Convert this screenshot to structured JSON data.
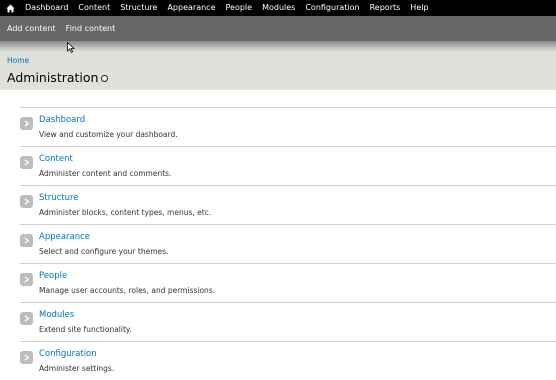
{
  "toolbar": {
    "items": [
      "Dashboard",
      "Content",
      "Structure",
      "Appearance",
      "People",
      "Modules",
      "Configuration",
      "Reports",
      "Help"
    ]
  },
  "shortcuts": {
    "items": [
      "Add content",
      "Find content"
    ]
  },
  "breadcrumb": {
    "home": "Home"
  },
  "page": {
    "title": "Administration"
  },
  "admin_list": [
    {
      "title": "Dashboard",
      "description": "View and customize your dashboard."
    },
    {
      "title": "Content",
      "description": "Administer content and comments."
    },
    {
      "title": "Structure",
      "description": "Administer blocks, content types, menus, etc."
    },
    {
      "title": "Appearance",
      "description": "Select and configure your themes."
    },
    {
      "title": "People",
      "description": "Manage user accounts, roles, and permissions."
    },
    {
      "title": "Modules",
      "description": "Extend site functionality."
    },
    {
      "title": "Configuration",
      "description": "Administer settings."
    }
  ],
  "colors": {
    "link": "#0074bd",
    "toolbar": "#000000",
    "shortcuts": "#666666",
    "header": "#e1e1dc"
  },
  "icons": {
    "home": "home-icon",
    "arrow": "arrow-right-icon",
    "star": "shortcut-star-icon",
    "cursor": "mouse-pointer-icon"
  }
}
